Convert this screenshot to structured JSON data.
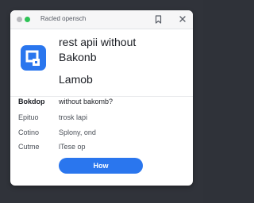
{
  "browser": {
    "url_text": "Racled opensch"
  },
  "header": {
    "headline_line1": "rest apii without",
    "headline_line2": "Bakonb",
    "subheading": "Lamob"
  },
  "details": {
    "rows": [
      {
        "label": "Bokdop",
        "value": "without bakomb?"
      },
      {
        "label": "Epituo",
        "value": "trosk lapi"
      },
      {
        "label": "Cotino",
        "value": "Splony, ond"
      },
      {
        "label": "Cutme",
        "value": "lTese op"
      }
    ]
  },
  "actions": {
    "primary_label": "How"
  },
  "colors": {
    "accent": "#2a76ee",
    "logo_blue": "#2a76ee",
    "background": "#30333a",
    "window": "#ffffff"
  },
  "icons": {
    "app_logo": "app-logo-icon",
    "bookmark": "bookmark-icon",
    "close": "close-icon"
  }
}
